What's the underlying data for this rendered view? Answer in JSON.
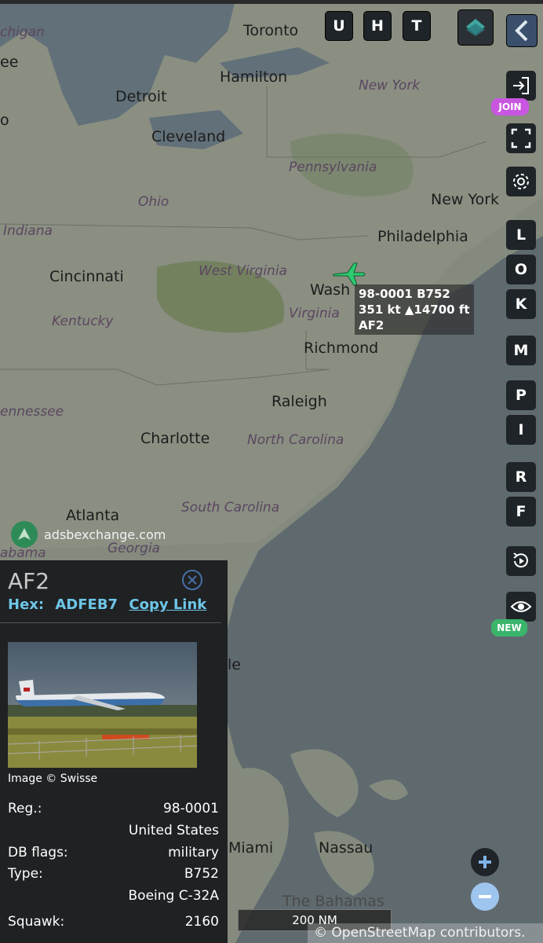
{
  "map": {
    "cities": [
      {
        "name": "Toronto",
        "cls": "city"
      },
      {
        "name": "Hamilton",
        "cls": "city"
      },
      {
        "name": "Detroit",
        "cls": "city"
      },
      {
        "name": "Cleveland",
        "cls": "city"
      },
      {
        "name": "New York",
        "cls": "state"
      },
      {
        "name": "Pennsylvania",
        "cls": "state"
      },
      {
        "name": "Ohio",
        "cls": "state"
      },
      {
        "name": "Indiana",
        "cls": "state"
      },
      {
        "name": "New York",
        "cls": "city"
      },
      {
        "name": "Philadelphia",
        "cls": "city"
      },
      {
        "name": "Cincinnati",
        "cls": "city"
      },
      {
        "name": "West Virginia",
        "cls": "state"
      },
      {
        "name": "Kentucky",
        "cls": "state"
      },
      {
        "name": "Wash",
        "cls": "city"
      },
      {
        "name": "Virginia",
        "cls": "state"
      },
      {
        "name": "Richmond",
        "cls": "city"
      },
      {
        "name": "ennessee",
        "cls": "state"
      },
      {
        "name": "Raleigh",
        "cls": "city"
      },
      {
        "name": "Charlotte",
        "cls": "city"
      },
      {
        "name": "North Carolina",
        "cls": "state"
      },
      {
        "name": "Atlanta",
        "cls": "city"
      },
      {
        "name": "South Carolina",
        "cls": "state"
      },
      {
        "name": "Georgia",
        "cls": "state"
      },
      {
        "name": "abama",
        "cls": "state"
      },
      {
        "name": "chigan",
        "cls": "state"
      },
      {
        "name": "ee",
        "cls": "city"
      },
      {
        "name": "o",
        "cls": "city"
      },
      {
        "name": "le",
        "cls": "city"
      },
      {
        "name": "Miami",
        "cls": "city"
      },
      {
        "name": "Nassau",
        "cls": "city"
      },
      {
        "name": "The Bahamas",
        "cls": "region"
      }
    ]
  },
  "toolbar": {
    "buttons": [
      "U",
      "H",
      "T"
    ],
    "layers_icon": "layers-icon",
    "collapse_icon": "chevron-left-icon"
  },
  "sidebar": {
    "join_badge": "JOIN",
    "new_badge": "NEW",
    "letters": [
      "L",
      "O",
      "K",
      "M",
      "P",
      "I",
      "R",
      "F"
    ]
  },
  "aircraft": {
    "label_line1": "98-0001 B752",
    "label_line2": "351 kt  ▲14700 ft",
    "label_line3": "AF2",
    "icon_color": "#2ecc71"
  },
  "watermark": {
    "text": "adsbexchange.com"
  },
  "panel": {
    "title": "AF2",
    "hex_label": "Hex:",
    "hex_value": "ADFEB7",
    "copy_link": "Copy Link",
    "photo_credit": "Image © Swisse",
    "rows": [
      {
        "k": "Reg.:",
        "v": "98-0001"
      },
      {
        "k": "",
        "v": "United States"
      },
      {
        "k": "DB flags:",
        "v": "military"
      },
      {
        "k": "Type:",
        "v": "B752"
      },
      {
        "k": "",
        "v": "Boeing C-32A"
      },
      {
        "k": "Squawk:",
        "v": "2160"
      }
    ]
  },
  "scale": {
    "text": "200 NM"
  },
  "attribution": {
    "text": "© OpenStreetMap contributors."
  }
}
